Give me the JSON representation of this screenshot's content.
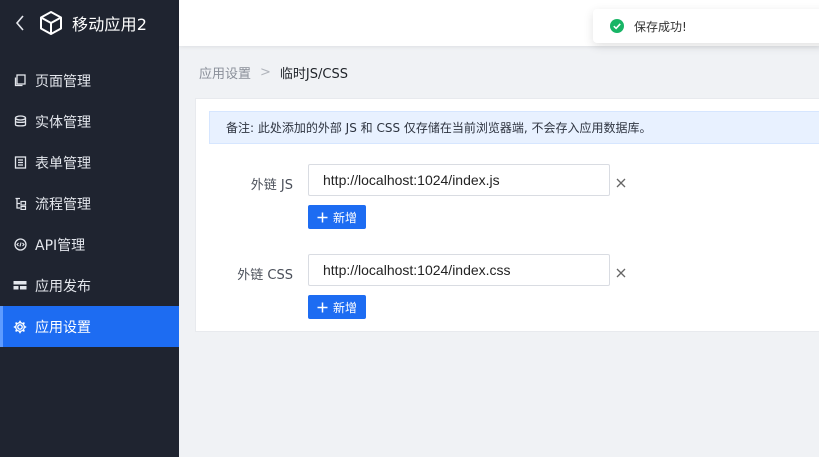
{
  "app": {
    "title": "移动应用2"
  },
  "sidebar": {
    "items": [
      {
        "label": "页面管理",
        "icon": "pages-icon",
        "active": false
      },
      {
        "label": "实体管理",
        "icon": "database-icon",
        "active": false
      },
      {
        "label": "表单管理",
        "icon": "form-icon",
        "active": false
      },
      {
        "label": "流程管理",
        "icon": "flow-icon",
        "active": false
      },
      {
        "label": "API管理",
        "icon": "api-icon",
        "active": false
      },
      {
        "label": "应用发布",
        "icon": "publish-icon",
        "active": false
      },
      {
        "label": "应用设置",
        "icon": "gear-icon",
        "active": true
      }
    ]
  },
  "toast": {
    "message": "保存成功!",
    "color": "#18b566"
  },
  "breadcrumb": {
    "parent": "应用设置",
    "separator": ">",
    "current": "临时JS/CSS"
  },
  "notice": {
    "text": "备注: 此处添加的外部 JS 和 CSS 仅存储在当前浏览器端, 不会存入应用数据库。"
  },
  "form": {
    "js": {
      "label": "外链 JS",
      "value": "http://localhost:1024/index.js",
      "add_label": "新增"
    },
    "css": {
      "label": "外链 CSS",
      "value": "http://localhost:1024/index.css",
      "add_label": "新增"
    }
  },
  "colors": {
    "primary": "#1d6cf2",
    "sidebar_bg": "#1f2430",
    "notice_bg": "#e8f1ff"
  }
}
